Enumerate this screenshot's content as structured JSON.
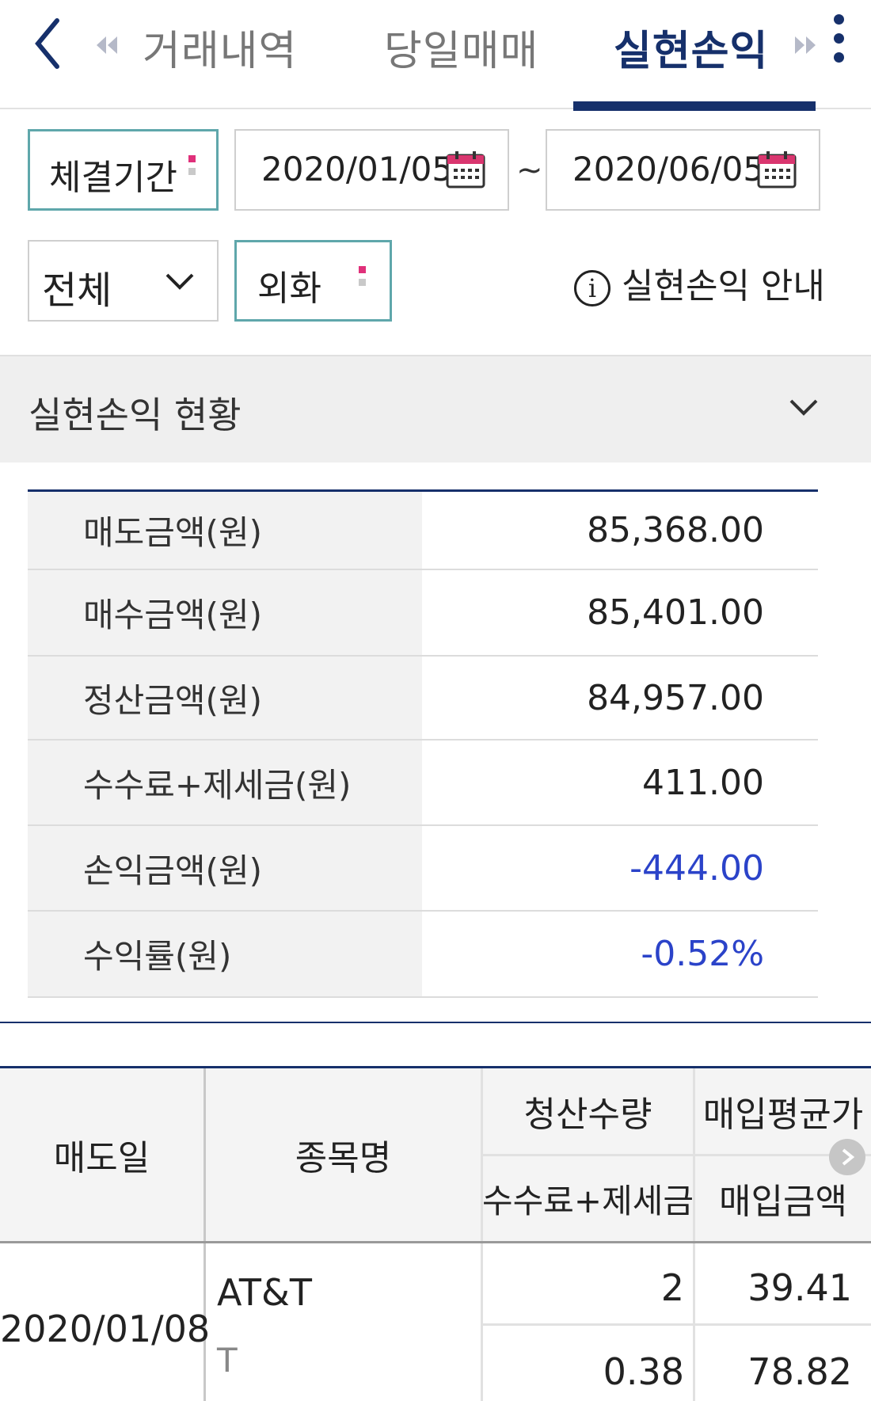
{
  "header": {
    "tabs": [
      {
        "label": "거래내역",
        "active": false
      },
      {
        "label": "당일매매",
        "active": false
      },
      {
        "label": "실현손익",
        "active": true
      }
    ]
  },
  "filters": {
    "period_label": "체결기간",
    "start_date": "2020/01/05",
    "separator": "~",
    "end_date": "2020/06/05",
    "scope_select": "전체",
    "currency_label": "외화",
    "info_link": "실현손익 안내",
    "required_marker_color": "#e0307a"
  },
  "summary": {
    "title": "실현손익 현황",
    "rows": [
      {
        "label": "매도금액(원)",
        "value": "85,368.00"
      },
      {
        "label": "매수금액(원)",
        "value": "85,401.00"
      },
      {
        "label": "정산금액(원)",
        "value": "84,957.00"
      },
      {
        "label": "수수료+제세금(원)",
        "value": "411.00"
      },
      {
        "label": "손익금액(원)",
        "value": "-444.00"
      },
      {
        "label": "수익률(원)",
        "value": "-0.52%"
      }
    ]
  },
  "detail": {
    "headers": {
      "sell_date": "매도일",
      "name": "종목명",
      "settle_qty": "청산수량",
      "avg_buy_price": "매입평균가",
      "fee_tax": "수수료+제세금",
      "buy_amount": "매입금액"
    },
    "rows": [
      {
        "sell_date": "2020/01/08",
        "name": "AT&T",
        "ticker": "T",
        "settle_qty": "2",
        "avg_buy_price": "39.41",
        "fee_tax": "0.38",
        "buy_amount": "78.82"
      }
    ]
  },
  "colors": {
    "accent_navy": "#16306b",
    "negative_blue": "#2b43c9",
    "teal_border": "#5fa7ab",
    "calendar_pink": "#d9366f"
  }
}
